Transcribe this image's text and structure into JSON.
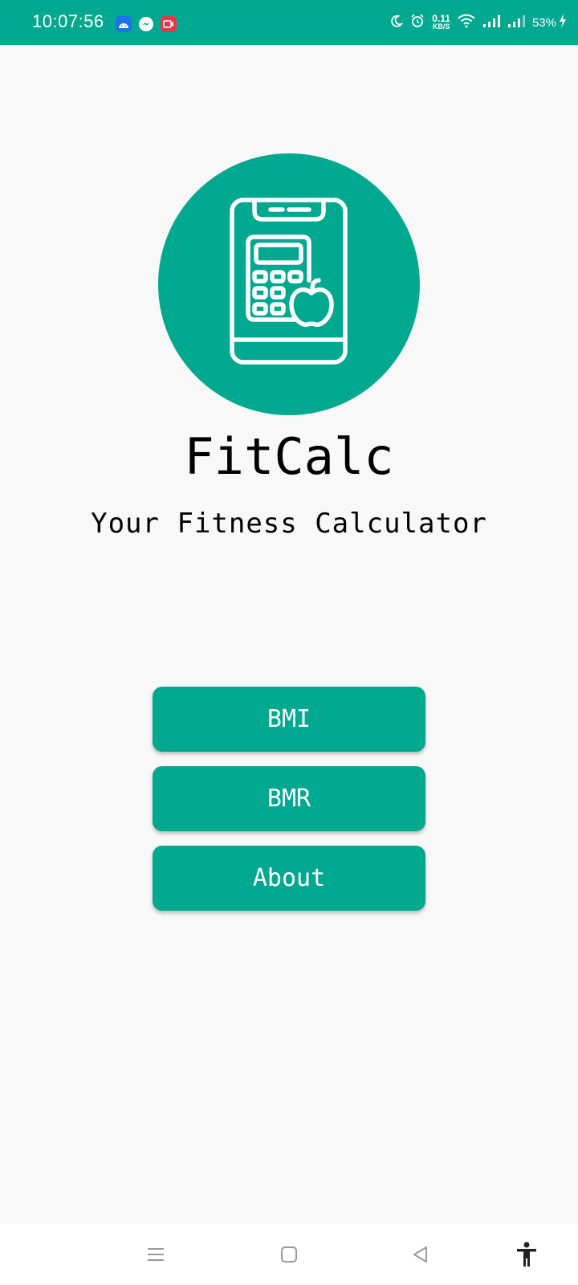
{
  "status_bar": {
    "time": "10:07:56",
    "net_speed_value": "0.11",
    "net_speed_unit": "KB/S",
    "battery": "53%",
    "icons": [
      "android-icon",
      "messenger-icon",
      "screen-recorder-icon",
      "moon-icon",
      "alarm-icon",
      "wifi-icon",
      "signal-icon",
      "signal-icon",
      "charging-icon"
    ],
    "background": "#00a890"
  },
  "app": {
    "logo_icon": "calculator-apple-icon",
    "title": "FitCalc",
    "subtitle": "Your Fitness Calculator"
  },
  "menu": {
    "buttons": [
      "BMI",
      "BMR",
      "About"
    ]
  },
  "nav_bar": {
    "icons": [
      "recents-icon",
      "home-icon",
      "back-icon",
      "accessibility-icon"
    ]
  },
  "colors": {
    "accent": "#00a890",
    "background": "#f8f8f8",
    "text": "#000000"
  }
}
